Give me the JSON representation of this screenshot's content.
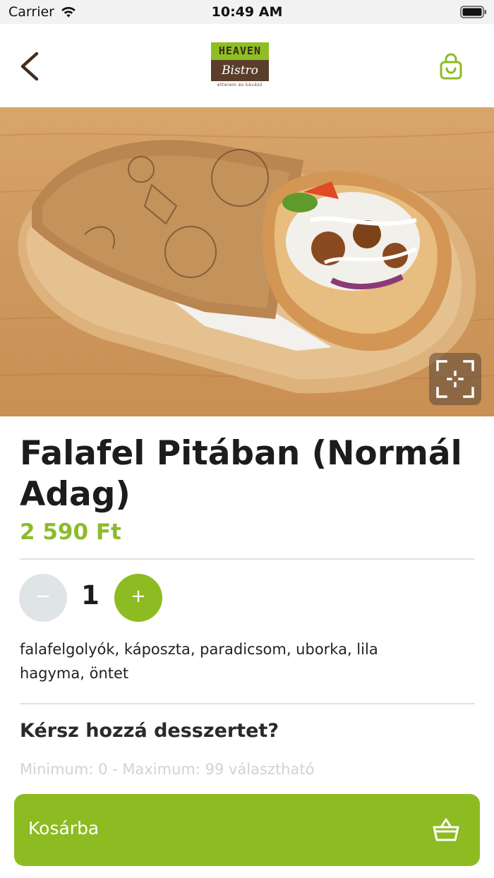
{
  "status_bar": {
    "carrier": "Carrier",
    "time": "10:49 AM"
  },
  "header": {
    "logo_top": "HEAVEN",
    "logo_bottom": "Bistro",
    "logo_sub": "étterem és kávézó"
  },
  "product": {
    "title": "Falafel Pitában (Normál Adag)",
    "price": "2 590 Ft",
    "quantity": "1",
    "minus_label": "−",
    "plus_label": "+",
    "description": "falafelgolyók, káposzta, paradicsom, uborka, lila hagyma, öntet"
  },
  "extras": {
    "title": "Kérsz hozzá desszertet?",
    "hint": "Minimum: 0 - Maximum: 99 választható"
  },
  "cart_button": {
    "label": "Kosárba"
  },
  "colors": {
    "accent": "#8dbb22",
    "logo_brown": "#5a3e2b"
  },
  "icons": [
    "back-chevron-icon",
    "shopping-bag-icon",
    "scan-icon",
    "basket-icon",
    "wifi-icon",
    "battery-icon"
  ]
}
